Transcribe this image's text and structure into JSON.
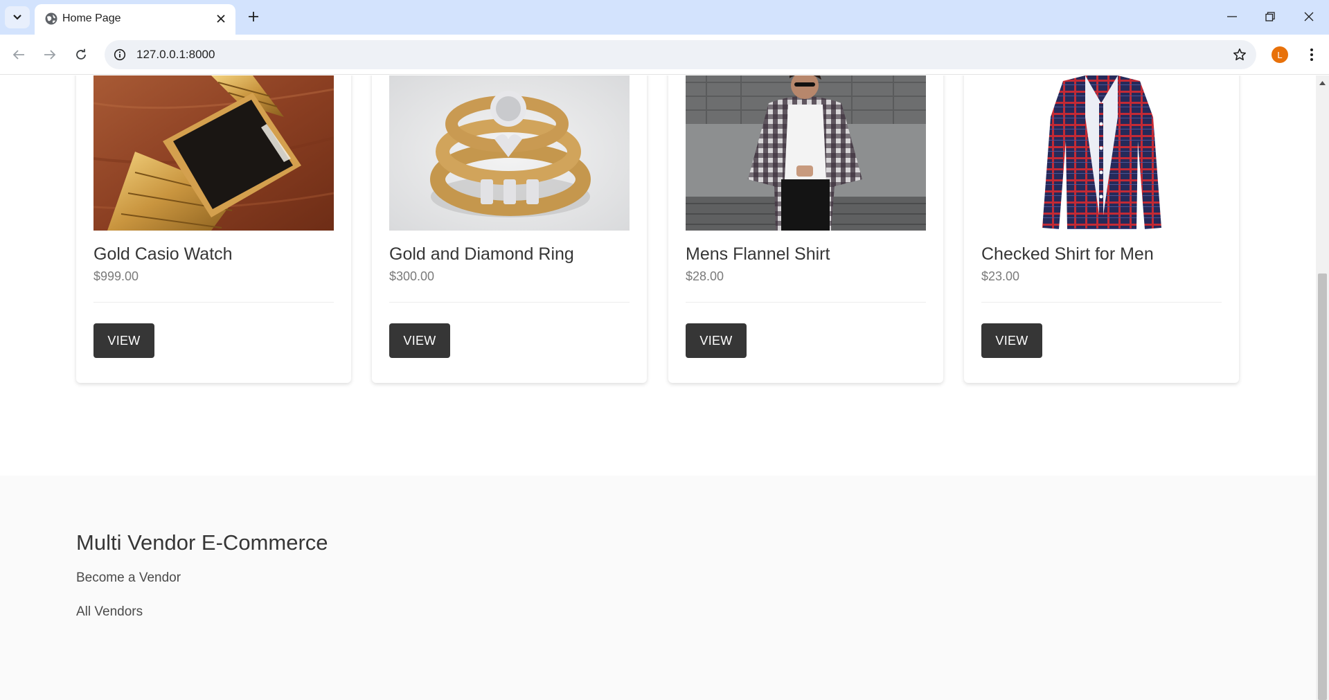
{
  "browser": {
    "tab_title": "Home Page",
    "url": "127.0.0.1:8000",
    "profile_initial": "L"
  },
  "products": [
    {
      "name": "Gold Casio Watch",
      "price": "$999.00",
      "button": "VIEW"
    },
    {
      "name": "Gold and Diamond Ring",
      "price": "$300.00",
      "button": "VIEW"
    },
    {
      "name": "Mens Flannel Shirt",
      "price": "$28.00",
      "button": "VIEW"
    },
    {
      "name": "Checked Shirt for Men",
      "price": "$23.00",
      "button": "VIEW"
    }
  ],
  "footer": {
    "title": "Multi Vendor E-Commerce",
    "links": [
      "Become a Vendor",
      "All Vendors"
    ]
  },
  "colors": {
    "tabbar_bg": "#d3e3fd",
    "button_dark": "#363636",
    "footer_bg": "#fafafa",
    "profile_orange": "#e8710a"
  }
}
